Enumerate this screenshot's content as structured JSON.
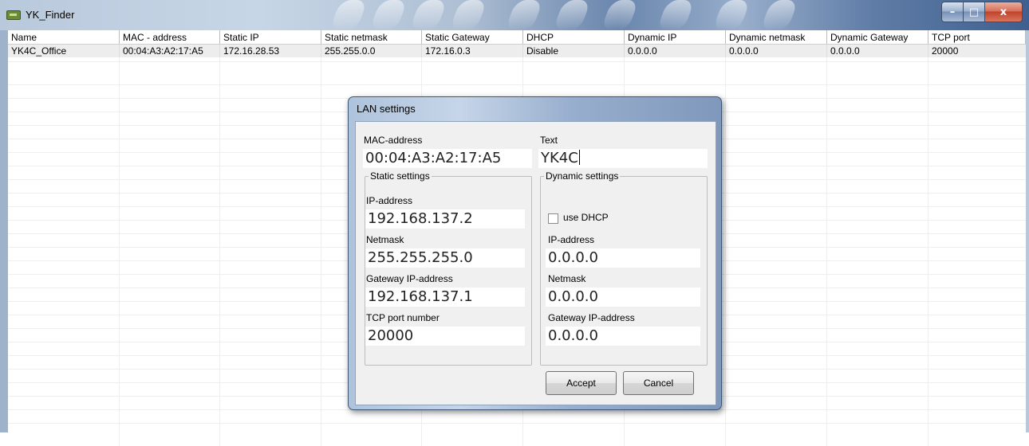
{
  "window": {
    "title": "YK_Finder",
    "controls": {
      "minimize": "–",
      "maximize": "□",
      "close": "x"
    }
  },
  "table": {
    "columns": [
      "Name",
      "MAC - address",
      "Static IP",
      "Static netmask",
      "Static Gateway",
      "DHCP",
      "Dynamic IP",
      "Dynamic netmask",
      "Dynamic Gateway",
      "TCP port"
    ],
    "rows": [
      [
        "YK4C_Office",
        "00:04:A3:A2:17:A5",
        "172.16.28.53",
        "255.255.0.0",
        "172.16.0.3",
        "Disable",
        "0.0.0.0",
        "0.0.0.0",
        "0.0.0.0",
        "20000"
      ]
    ]
  },
  "dialog": {
    "title": "LAN settings",
    "mac_label": "MAC-address",
    "mac_value": "00:04:A3:A2:17:A5",
    "text_label": "Text",
    "text_value": "YK4C",
    "static": {
      "legend": "Static settings",
      "ip_label": "IP-address",
      "ip_value": "192.168.137.2",
      "netmask_label": "Netmask",
      "netmask_value": "255.255.255.0",
      "gateway_label": "Gateway IP-address",
      "gateway_value": "192.168.137.1",
      "port_label": "TCP port number",
      "port_value": "20000"
    },
    "dynamic": {
      "legend": "Dynamic settings",
      "dhcp_label": "use DHCP",
      "dhcp_checked": false,
      "ip_label": "IP-address",
      "ip_value": "0.0.0.0",
      "netmask_label": "Netmask",
      "netmask_value": "0.0.0.0",
      "gateway_label": "Gateway IP-address",
      "gateway_value": "0.0.0.0"
    },
    "accept_label": "Accept",
    "cancel_label": "Cancel"
  }
}
